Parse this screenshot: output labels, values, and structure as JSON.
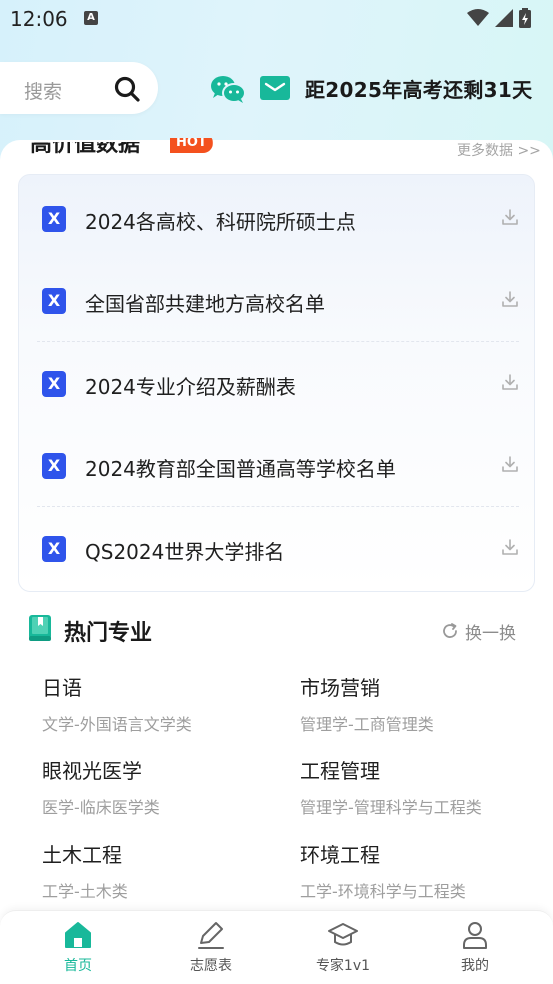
{
  "status_bar": {
    "time": "12:06",
    "notification_letter": "A"
  },
  "header": {
    "search_placeholder": "搜索",
    "countdown": "距2025年高考还剩31天"
  },
  "data_section": {
    "title": "高价值数据",
    "badge": "HOT",
    "more": "更多数据 >>",
    "files": [
      {
        "name": "2024各高校、科研院所硕士点",
        "icon_letter": "X"
      },
      {
        "name": "全国省部共建地方高校名单",
        "icon_letter": "X"
      },
      {
        "name": "2024专业介绍及薪酬表",
        "icon_letter": "X"
      },
      {
        "name": "2024教育部全国普通高等学校名单",
        "icon_letter": "X"
      },
      {
        "name": "QS2024世界大学排名",
        "icon_letter": "X"
      }
    ]
  },
  "majors_section": {
    "title": "热门专业",
    "refresh": "换一换",
    "items": [
      {
        "name": "日语",
        "category": "文学-外国语言文学类"
      },
      {
        "name": "市场营销",
        "category": "管理学-工商管理类"
      },
      {
        "name": "眼视光医学",
        "category": "医学-临床医学类"
      },
      {
        "name": "工程管理",
        "category": "管理学-管理科学与工程类"
      },
      {
        "name": "土木工程",
        "category": "工学-土木类"
      },
      {
        "name": "环境工程",
        "category": "工学-环境科学与工程类"
      }
    ]
  },
  "bottom_nav": {
    "items": [
      {
        "label": "首页",
        "icon": "home-icon",
        "active": true
      },
      {
        "label": "志愿表",
        "icon": "pencil-icon",
        "active": false
      },
      {
        "label": "专家1v1",
        "icon": "graduation-cap-icon",
        "active": false
      },
      {
        "label": "我的",
        "icon": "user-icon",
        "active": false
      }
    ]
  },
  "colors": {
    "accent": "#18b89a",
    "file_icon": "#2f54eb",
    "hot_badge": "#f4511e"
  }
}
